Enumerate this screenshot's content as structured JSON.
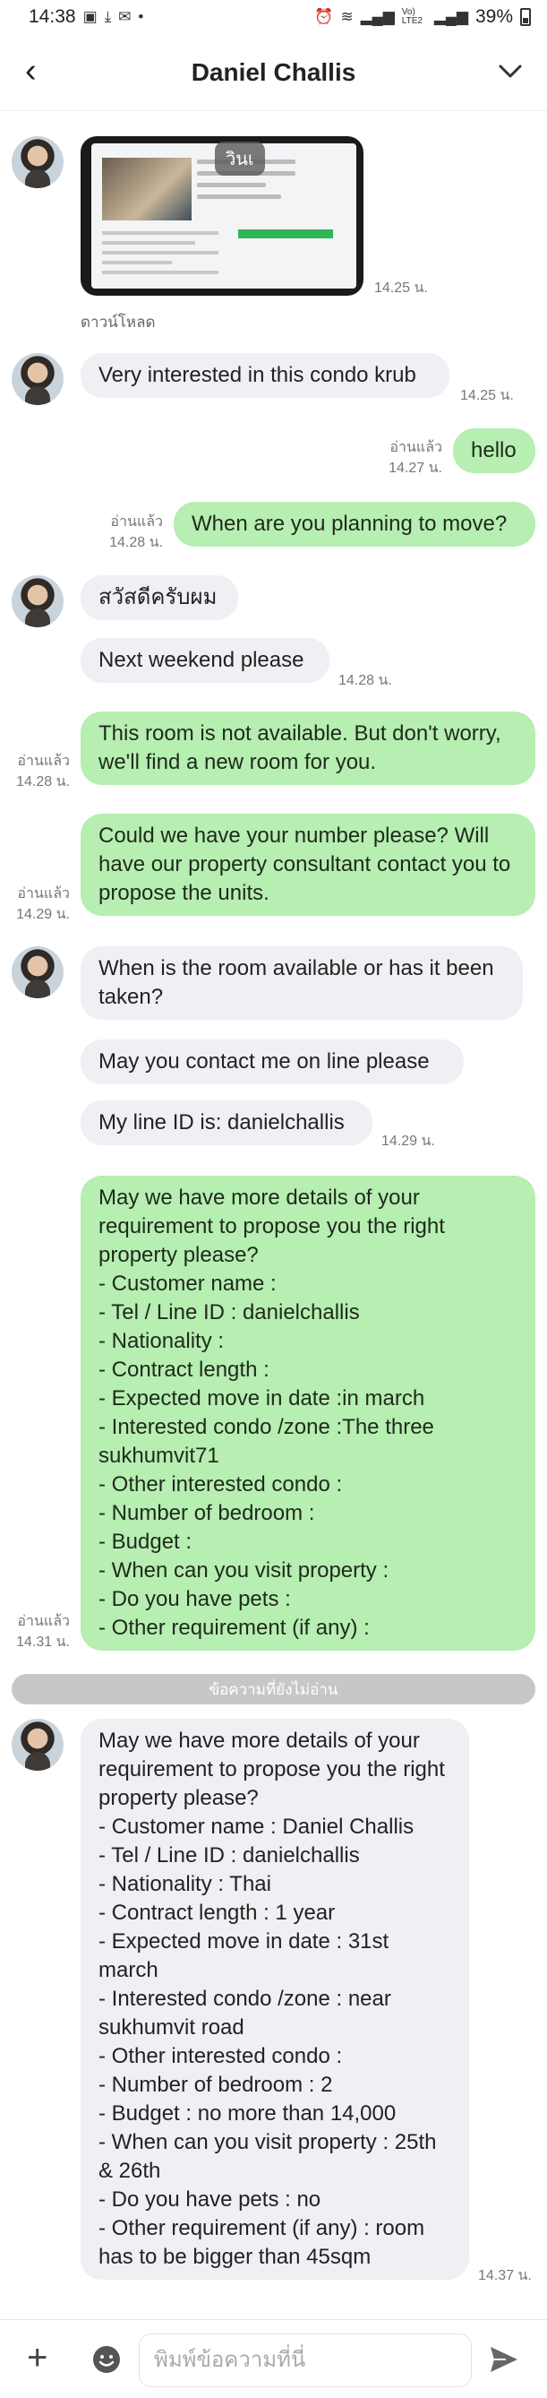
{
  "status_bar": {
    "time": "14:38",
    "left_icons": [
      "image-icon",
      "download-icon",
      "mail-icon",
      "dot-icon"
    ],
    "right_icons": [
      "alarm-icon",
      "wifi-icon",
      "signal-icon",
      "volte-icon",
      "signal2-icon"
    ],
    "network_text": "Vo) LTE2",
    "battery": "39%"
  },
  "header": {
    "title": "Daniel Challis"
  },
  "colors": {
    "outgoing_bubble": "#b7eeb1",
    "incoming_bubble": "#eef0f3",
    "divider": "#c7c7c7"
  },
  "messages": {
    "m0": {
      "image_badge": "วินเ",
      "time": "14.25 น.",
      "action": "ดาวน์โหลด"
    },
    "m1": {
      "text": "Very interested in this condo krub",
      "time": "14.25 น."
    },
    "m2": {
      "read": "อ่านแล้ว",
      "time": "14.27 น.",
      "text": "hello"
    },
    "m3": {
      "read": "อ่านแล้ว",
      "time": "14.28 น.",
      "text": "When are you planning to move?"
    },
    "m4": {
      "text": "สวัสดีครับผม"
    },
    "m5": {
      "text": "Next weekend please",
      "time": "14.28 น."
    },
    "m6": {
      "read": "อ่านแล้ว",
      "time": "14.28 น.",
      "text": "This room is not available.  But don't worry, we'll find a new room for you."
    },
    "m7": {
      "read": "อ่านแล้ว",
      "time": "14.29 น.",
      "text": "Could we have your number please? Will have our property consultant contact you to propose the units."
    },
    "m8": {
      "text": "When is the room available or has it been taken?"
    },
    "m9": {
      "text": "May you contact me on line please"
    },
    "m10": {
      "text": "My line ID is: danielchallis",
      "time": "14.29 น."
    },
    "m11": {
      "read": "อ่านแล้ว",
      "time": "14.31 น.",
      "text": "May we have more details of your requirement to propose you the right property please?\n- Customer name :\n- Tel / Line ID : danielchallis\n- Nationality :\n- Contract length :\n- Expected move in date :in march\n- Interested condo /zone :The three sukhumvit71\n- Other interested condo :\n- Number of bedroom  :\n- Budget :\n- When can you visit property :\n- Do you have pets :\n- Other requirement (if any) :"
    },
    "divider": "ข้อความที่ยังไม่อ่าน",
    "m12": {
      "time": "14.37 น.",
      "text": "May we have more details of your requirement to propose you the right property please?\n- Customer name : Daniel Challis\n- Tel / Line ID : danielchallis\n- Nationality : Thai\n- Contract length : 1 year\n- Expected move in date : 31st march\n- Interested condo /zone : near sukhumvit road\n- Other interested condo :\n- Number of bedroom  : 2\n- Budget : no more than 14,000\n- When can you visit property : 25th & 26th\n- Do you have pets : no\n- Other requirement (if any) : room has to be bigger than 45sqm"
    }
  },
  "input": {
    "placeholder": "พิมพ์ข้อความที่นี่",
    "value": ""
  }
}
